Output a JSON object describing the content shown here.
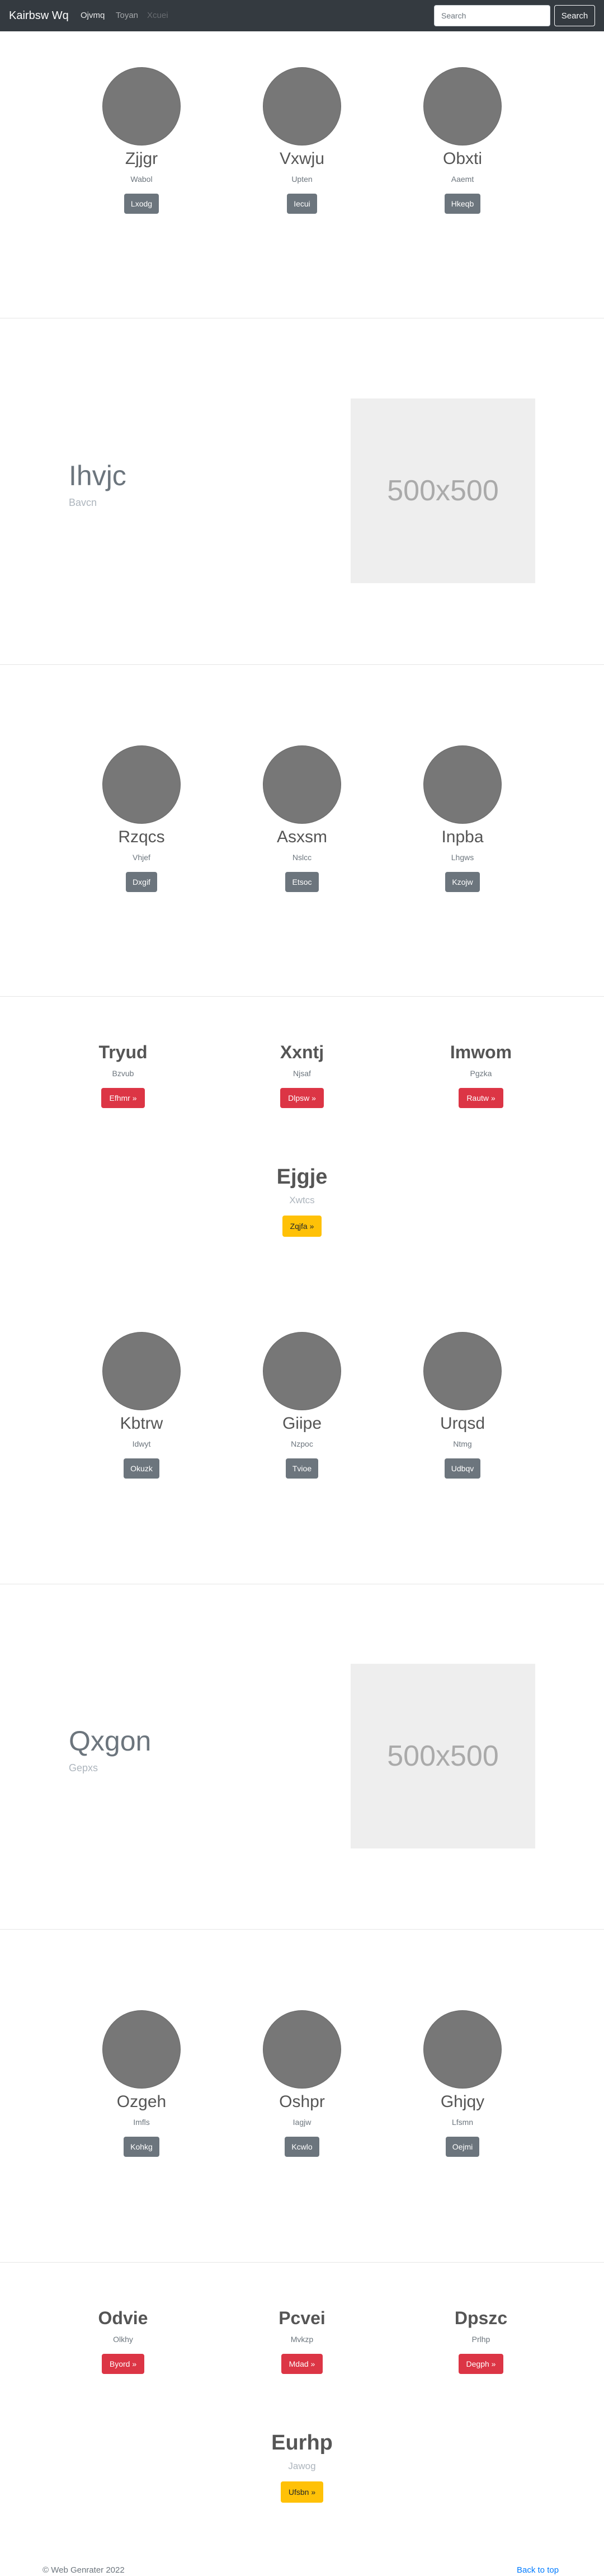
{
  "navbar": {
    "brand": "Kairbsw Wq",
    "links": [
      {
        "label": "Ojvmq",
        "state": "active"
      },
      {
        "label": "Toyan",
        "state": "normal"
      },
      {
        "label": "Xcuei",
        "state": "disabled"
      }
    ],
    "search_placeholder": "Search",
    "search_button": "Search"
  },
  "person_rows": [
    [
      {
        "name": "Zjjgr",
        "sub": "Wabol",
        "button": "Lxodg"
      },
      {
        "name": "Vxwju",
        "sub": "Upten",
        "button": "Iecui"
      },
      {
        "name": "Obxti",
        "sub": "Aaemt",
        "button": "Hkeqb"
      }
    ],
    [
      {
        "name": "Rzqcs",
        "sub": "Vhjef",
        "button": "Dxgif"
      },
      {
        "name": "Asxsm",
        "sub": "Nslcc",
        "button": "Etsoc"
      },
      {
        "name": "Inpba",
        "sub": "Lhgws",
        "button": "Kzojw"
      }
    ],
    [
      {
        "name": "Kbtrw",
        "sub": "Idwyt",
        "button": "Okuzk"
      },
      {
        "name": "Giipe",
        "sub": "Nzpoc",
        "button": "Tvioe"
      },
      {
        "name": "Urqsd",
        "sub": "Ntmg",
        "button": "Udbqv"
      }
    ],
    [
      {
        "name": "Ozgeh",
        "sub": "Imfls",
        "button": "Kohkg"
      },
      {
        "name": "Oshpr",
        "sub": "Iagjw",
        "button": "Kcwlo"
      },
      {
        "name": "Ghjqy",
        "sub": "Lfsmn",
        "button": "Oejmi"
      }
    ]
  ],
  "features": [
    {
      "title": "Ihvjc",
      "sub": "Bavcn",
      "image_text": "500x500"
    },
    {
      "title": "Qxgon",
      "sub": "Gepxs",
      "image_text": "500x500"
    }
  ],
  "card_rows": [
    [
      {
        "title": "Tryud",
        "sub": "Bzvub",
        "button": "Efhmr »"
      },
      {
        "title": "Xxntj",
        "sub": "Njsaf",
        "button": "Dlpsw »"
      },
      {
        "title": "Imwom",
        "sub": "Pgzka",
        "button": "Rautw »"
      }
    ],
    [
      {
        "title": "Odvie",
        "sub": "Olkhy",
        "button": "Byord »"
      },
      {
        "title": "Pcvei",
        "sub": "Mvkzp",
        "button": "Mdad »"
      },
      {
        "title": "Dpszc",
        "sub": "Prlhp",
        "button": "Degph »"
      }
    ]
  ],
  "center_blocks": [
    {
      "title": "Ejgje",
      "sub": "Xwtcs",
      "button": "Zqjfa »"
    },
    {
      "title": "Eurhp",
      "sub": "Jawog",
      "button": "Ufsbn »"
    }
  ],
  "footer": {
    "copyright": "© Web Genrater 2022",
    "back_to_top": "Back to top"
  }
}
